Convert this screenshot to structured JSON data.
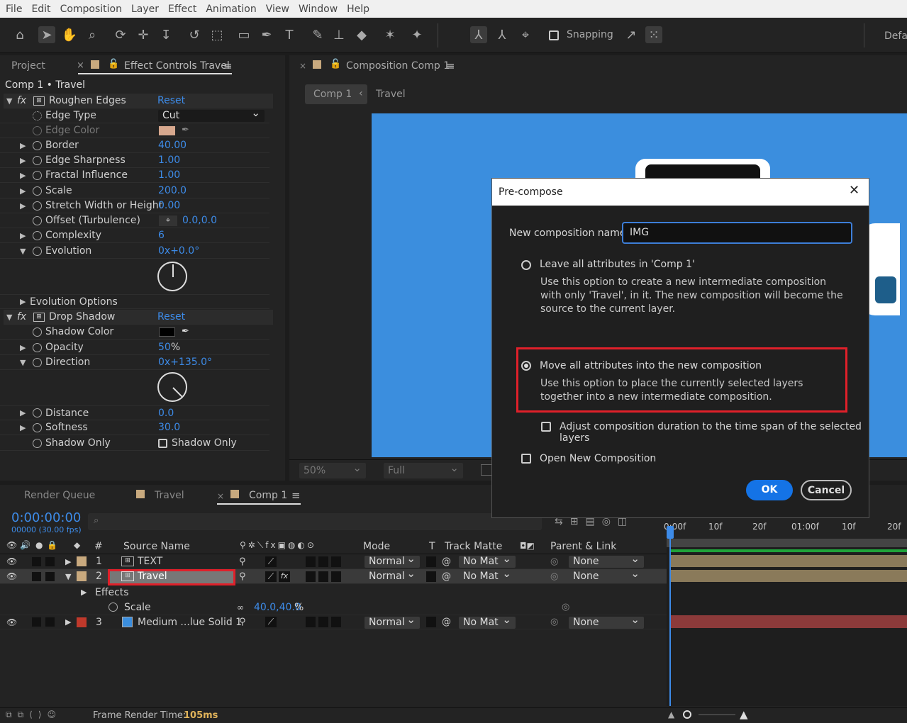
{
  "menu": [
    "File",
    "Edit",
    "Composition",
    "Layer",
    "Effect",
    "Animation",
    "View",
    "Window",
    "Help"
  ],
  "toolbar": {
    "snapping": "Snapping",
    "workspace": "Defa"
  },
  "left_panel": {
    "project_tab": "Project",
    "close": "×",
    "effect_tab": "Effect Controls Travel",
    "menu": "≡",
    "comp_label": "Comp 1 • Travel"
  },
  "effects": {
    "roughen": {
      "name": "Roughen Edges",
      "reset": "Reset"
    },
    "edge_type": {
      "name": "Edge Type",
      "value": "Cut"
    },
    "edge_color": {
      "name": "Edge Color",
      "color": "#d7a88e"
    },
    "border": {
      "name": "Border",
      "value": "40.00"
    },
    "edge_sharpness": {
      "name": "Edge Sharpness",
      "value": "1.00"
    },
    "fractal": {
      "name": "Fractal Influence",
      "value": "1.00"
    },
    "scale": {
      "name": "Scale",
      "value": "200.0"
    },
    "stretch": {
      "name": "Stretch Width or Height",
      "value": "0.00"
    },
    "offset": {
      "name": "Offset (Turbulence)",
      "value": "0.0,0.0"
    },
    "complexity": {
      "name": "Complexity",
      "value": "6"
    },
    "evolution": {
      "name": "Evolution",
      "value_a": "0x",
      "value_b": "+0.0°"
    },
    "evolution_options": "Evolution Options",
    "drop_shadow": {
      "name": "Drop Shadow",
      "reset": "Reset"
    },
    "shadow_color": {
      "name": "Shadow Color",
      "color": "#000000"
    },
    "opacity": {
      "name": "Opacity",
      "value": "50",
      "unit": "%"
    },
    "direction": {
      "name": "Direction",
      "value_a": "0x",
      "value_b": "+135.0°"
    },
    "distance": {
      "name": "Distance",
      "value": "0.0"
    },
    "softness": {
      "name": "Softness",
      "value": "30.0"
    },
    "shadow_only": {
      "name": "Shadow Only",
      "value": "Shadow Only"
    }
  },
  "comp_panel": {
    "tab": "Composition Comp 1",
    "crumb1": "Comp 1",
    "crumb2": "Travel",
    "zoom": "50%",
    "quality": "Full",
    "bg_color": "#3b8ede"
  },
  "dialog": {
    "title": "Pre-compose",
    "name_label": "New composition name:",
    "name_value": "IMG",
    "opt1_label": "Leave all attributes in 'Comp 1'",
    "opt1_desc": "Use this option to create a new intermediate composition with only 'Travel', in it. The new composition will become the source to the current layer.",
    "opt2_label": "Move all attributes into the new composition",
    "opt2_desc": "Use this option to place the currently selected layers together into a new intermediate composition.",
    "adjust_label": "Adjust composition duration to the time span of the selected layers",
    "open_label": "Open New Composition",
    "ok": "OK",
    "cancel": "Cancel"
  },
  "timeline": {
    "render_queue": "Render Queue",
    "travel_tab": "Travel",
    "comp_tab": "Comp 1",
    "close": "×",
    "menu": "≡",
    "timecode": "0:00:00:00",
    "fps": "00000 (30.00 fps)",
    "cols": {
      "num": "#",
      "source": "Source Name",
      "mode": "Mode",
      "t": "T",
      "matte": "Track Matte",
      "parent": "Parent & Link"
    },
    "ruler": [
      "0:00f",
      "10f",
      "20f",
      "01:00f",
      "10f",
      "20f"
    ],
    "layers": [
      {
        "num": "1",
        "name": "TEXT",
        "mode": "Normal",
        "matte": "No Mat",
        "parent": "None",
        "label": "#c8a97e",
        "bar": "#8a7a5a"
      },
      {
        "num": "2",
        "name": "Travel",
        "mode": "Normal",
        "matte": "No Mat",
        "parent": "None",
        "label": "#c8a97e",
        "bar": "#8a7a5a"
      },
      {
        "num": "3",
        "name": "Medium ...lue Solid 1",
        "mode": "Normal",
        "matte": "No Mat",
        "parent": "None",
        "label": "#c0392b",
        "bar": "#8c3a3a"
      }
    ],
    "effects_label": "Effects",
    "scale_label": "Scale",
    "scale_value": "40.0,40.0",
    "scale_unit": "%",
    "frame_render_label": "Frame Render Time:",
    "frame_render_value": "105ms"
  }
}
